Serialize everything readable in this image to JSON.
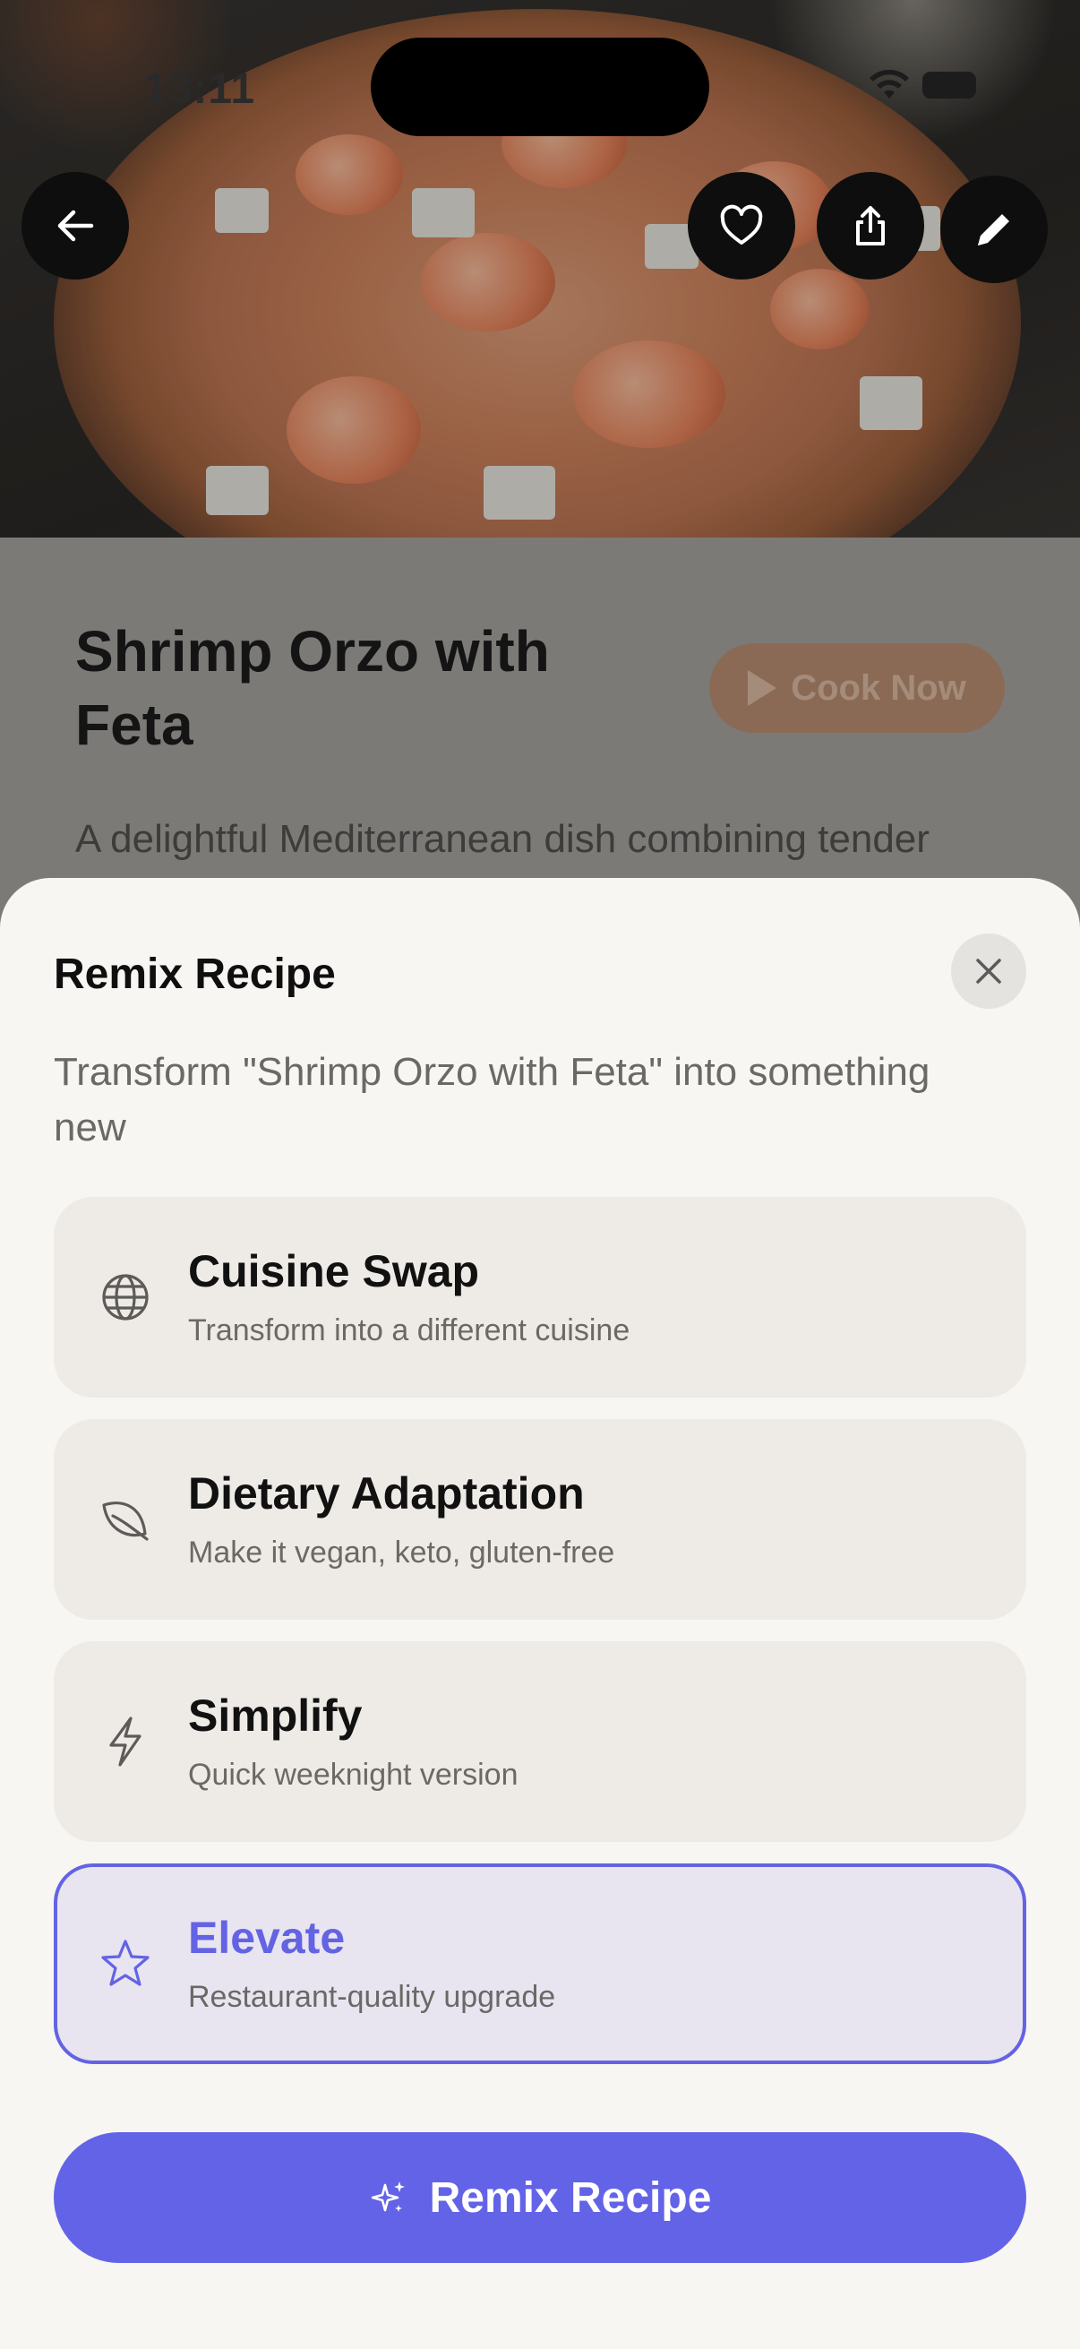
{
  "status_bar": {
    "time": "13:11"
  },
  "header": {
    "back_icon": "arrow-left-icon",
    "favorite_icon": "heart-icon",
    "share_icon": "share-icon",
    "edit_icon": "pencil-icon"
  },
  "recipe": {
    "title": "Shrimp Orzo with Feta",
    "cook_now_label": "Cook Now",
    "description": "A delightful Mediterranean dish combining tender"
  },
  "sheet": {
    "title": "Remix Recipe",
    "subtitle": "Transform \"Shrimp Orzo with Feta\" into something new",
    "options": [
      {
        "label": "Cuisine Swap",
        "description": "Transform into a different cuisine",
        "icon": "globe-icon",
        "selected": false
      },
      {
        "label": "Dietary Adaptation",
        "description": "Make it vegan, keto, gluten-free",
        "icon": "leaf-icon",
        "selected": false
      },
      {
        "label": "Simplify",
        "description": "Quick weeknight version",
        "icon": "lightning-icon",
        "selected": false
      },
      {
        "label": "Elevate",
        "description": "Restaurant-quality upgrade",
        "icon": "star-icon",
        "selected": true
      }
    ],
    "action_label": "Remix Recipe",
    "action_icon": "sparkles-icon"
  },
  "colors": {
    "accent": "#6363e8",
    "sheet_background": "#f8f6f2",
    "option_background": "#eeebe6",
    "selected_background": "#e8e5f1"
  }
}
